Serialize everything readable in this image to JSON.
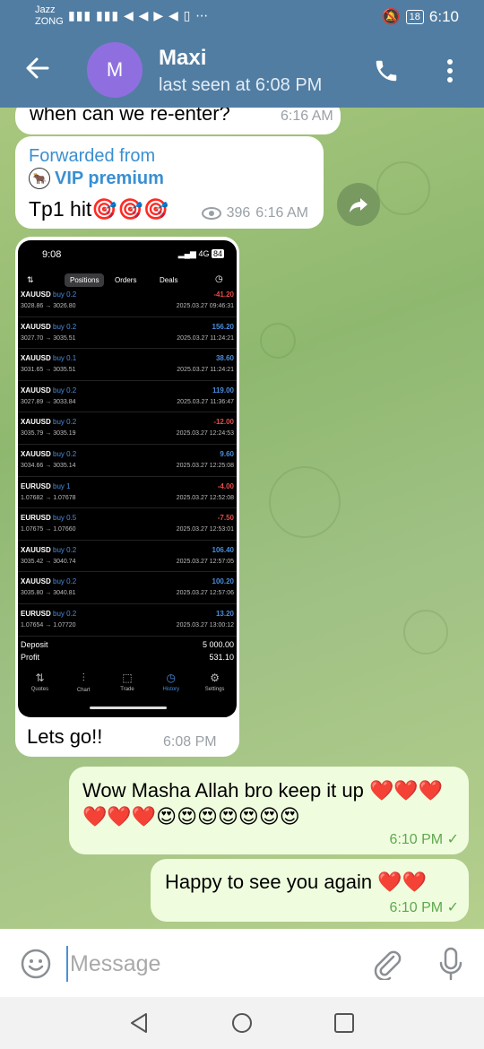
{
  "status_bar": {
    "carrier_line1": "Jazz",
    "carrier_line2": "ZONG",
    "battery": "18",
    "time": "6:10"
  },
  "header": {
    "avatar_letter": "M",
    "name": "Maxi",
    "status": "last seen at 6:08 PM"
  },
  "messages": {
    "m1": {
      "text": "when can we re-enter?",
      "time": "6:16 AM"
    },
    "m2": {
      "forwarded_label": "Forwarded from",
      "channel": "VIP premium",
      "text": "Tp1 hit🎯🎯🎯",
      "views": "396",
      "time": "6:16 AM"
    },
    "m3": {
      "caption": "Lets go!!",
      "time": "6:08 PM",
      "screenshot": {
        "clock": "9:08",
        "signal": "4G",
        "battery": "84",
        "tabs": [
          "Positions",
          "Orders",
          "Deals"
        ],
        "trades": [
          {
            "symbol": "XAUUSD",
            "side": "buy 0.2",
            "prices": "3028.86 → 3026.80",
            "profit": "-41.20",
            "datetime": "2025.03.27 09:46:31"
          },
          {
            "symbol": "XAUUSD",
            "side": "buy 0.2",
            "prices": "3027.70 → 3035.51",
            "profit": "156.20",
            "datetime": "2025.03.27 11:24:21"
          },
          {
            "symbol": "XAUUSD",
            "side": "buy 0.1",
            "prices": "3031.65 → 3035.51",
            "profit": "38.60",
            "datetime": "2025.03.27 11:24:21"
          },
          {
            "symbol": "XAUUSD",
            "side": "buy 0.2",
            "prices": "3027.89 → 3033.84",
            "profit": "119.00",
            "datetime": "2025.03.27 11:36:47"
          },
          {
            "symbol": "XAUUSD",
            "side": "buy 0.2",
            "prices": "3035.79 → 3035.19",
            "profit": "-12.00",
            "datetime": "2025.03.27 12:24:53"
          },
          {
            "symbol": "XAUUSD",
            "side": "buy 0.2",
            "prices": "3034.66 → 3035.14",
            "profit": "9.60",
            "datetime": "2025.03.27 12:25:08"
          },
          {
            "symbol": "EURUSD",
            "side": "buy 1",
            "prices": "1.07682 → 1.07678",
            "profit": "-4.00",
            "datetime": "2025.03.27 12:52:08"
          },
          {
            "symbol": "EURUSD",
            "side": "buy 0.5",
            "prices": "1.07675 → 1.07660",
            "profit": "-7.50",
            "datetime": "2025.03.27 12:53:01"
          },
          {
            "symbol": "XAUUSD",
            "side": "buy 0.2",
            "prices": "3035.42 → 3040.74",
            "profit": "106.40",
            "datetime": "2025.03.27 12:57:05"
          },
          {
            "symbol": "XAUUSD",
            "side": "buy 0.2",
            "prices": "3035.80 → 3040.81",
            "profit": "100.20",
            "datetime": "2025.03.27 12:57:06"
          },
          {
            "symbol": "EURUSD",
            "side": "buy 0.2",
            "prices": "1.07654 → 1.07720",
            "profit": "13.20",
            "datetime": "2025.03.27 13:00:12"
          }
        ],
        "deposit_label": "Deposit",
        "deposit_value": "5 000.00",
        "profit_label": "Profit",
        "profit_value": "531.10",
        "nav": [
          "Quotes",
          "Chart",
          "Trade",
          "History",
          "Settings"
        ]
      }
    },
    "m4": {
      "text": "Wow Masha Allah bro keep it up ❤️❤️❤️❤️❤️❤️😍😍😍😍😍😍😍",
      "time": "6:10 PM"
    },
    "m5": {
      "text": "Happy to see you again ❤️❤️",
      "time": "6:10 PM"
    }
  },
  "input": {
    "placeholder": "Message"
  },
  "colors": {
    "header": "#517da2",
    "outgoing_bubble": "#effdde",
    "link": "#3a8fd1"
  }
}
